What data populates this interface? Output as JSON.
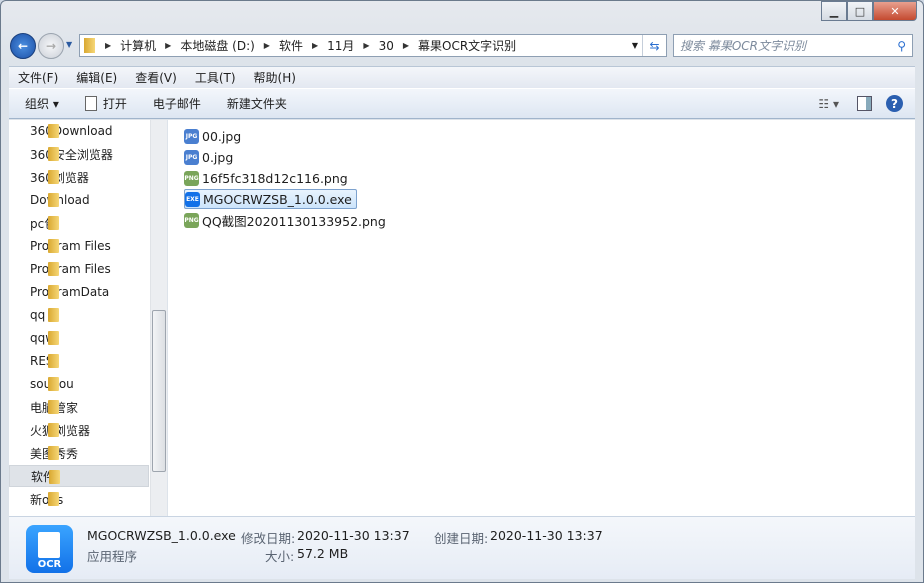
{
  "address": {
    "crumbs": [
      "计算机",
      "本地磁盘 (D:)",
      "软件",
      "11月",
      "30",
      "幕果OCR文字识别"
    ]
  },
  "search": {
    "placeholder": "搜索 幕果OCR文字识别"
  },
  "menu": [
    "文件(F)",
    "编辑(E)",
    "查看(V)",
    "工具(T)",
    "帮助(H)"
  ],
  "toolbar": {
    "organize": "组织 ▾",
    "open": "打开",
    "email": "电子邮件",
    "new_folder": "新建文件夹"
  },
  "nav": [
    "360Download",
    "360安全浏览器",
    "360浏览器",
    "Download",
    "pc包",
    "Program Files",
    "Program Files",
    "ProgramData",
    "qq",
    "qqwj",
    "RES",
    "sougou",
    "电脑管家",
    "火狐浏览器",
    "美图秀秀",
    "软件",
    "新obs"
  ],
  "nav_selected": "软件",
  "files": [
    {
      "name": "00.jpg",
      "type": "JPG"
    },
    {
      "name": "0.jpg",
      "type": "JPG"
    },
    {
      "name": "16f5fc318d12c116.png",
      "type": "PNG"
    },
    {
      "name": "MGOCRWZSB_1.0.0.exe",
      "type": "EXE",
      "selected": true
    },
    {
      "name": "QQ截图20201130133952.png",
      "type": "PNG"
    }
  ],
  "details": {
    "name": "MGOCRWZSB_1.0.0.exe",
    "kind": "应用程序",
    "modified_label": "修改日期:",
    "modified": "2020-11-30 13:37",
    "created_label": "创建日期:",
    "created": "2020-11-30 13:37",
    "size_label": "大小:",
    "size": "57.2 MB",
    "icon_text": "OCR"
  },
  "colors": {
    "accent": "#1271e8",
    "jpg": "#4a7fd0",
    "png": "#7aa55a"
  }
}
